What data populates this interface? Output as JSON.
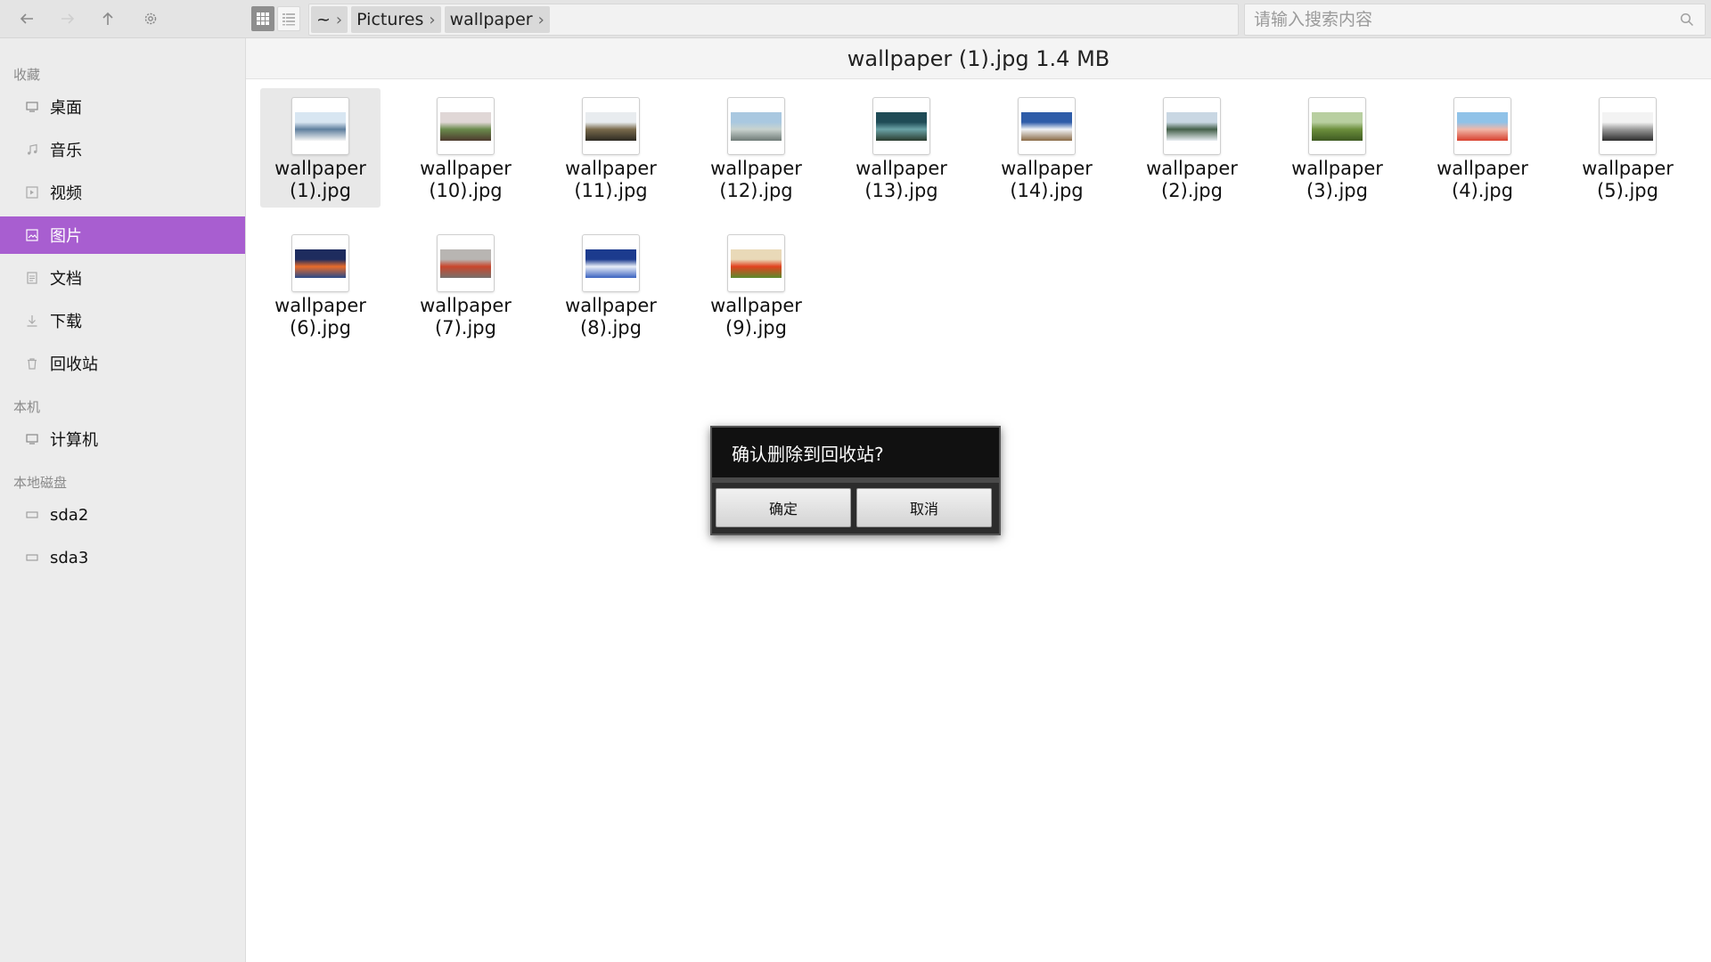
{
  "toolbar": {
    "back_icon": "arrow-left-icon",
    "forward_icon": "arrow-right-icon",
    "up_icon": "arrow-up-icon",
    "settings_icon": "gear-icon",
    "grid_view_icon": "grid-view-icon",
    "list_view_icon": "list-view-icon"
  },
  "breadcrumb": {
    "items": [
      "~",
      "Pictures",
      "wallpaper"
    ]
  },
  "search": {
    "placeholder": "请输入搜索内容",
    "value": ""
  },
  "sidebar": {
    "favorites_title": "收藏",
    "favorites": [
      {
        "label": "桌面",
        "icon": "desktop-icon"
      },
      {
        "label": "音乐",
        "icon": "music-icon"
      },
      {
        "label": "视频",
        "icon": "video-icon"
      },
      {
        "label": "图片",
        "icon": "picture-icon",
        "active": true
      },
      {
        "label": "文档",
        "icon": "document-icon"
      },
      {
        "label": "下载",
        "icon": "download-icon"
      },
      {
        "label": "回收站",
        "icon": "trash-icon"
      }
    ],
    "computer_title": "本机",
    "computer": [
      {
        "label": "计算机",
        "icon": "computer-icon"
      }
    ],
    "disks_title": "本地磁盘",
    "disks": [
      {
        "label": "sda2",
        "icon": "drive-icon"
      },
      {
        "label": "sda3",
        "icon": "drive-icon"
      }
    ]
  },
  "info_bar": {
    "text": "wallpaper (1).jpg 1.4 MB"
  },
  "files": [
    {
      "line1": "wallpaper",
      "line2": "(1).jpg",
      "selected": true,
      "colors": [
        "#d8e6f2",
        "#5f7f9e",
        "#f5f5f5"
      ]
    },
    {
      "line1": "wallpaper",
      "line2": "(10).jpg",
      "colors": [
        "#e0d7d6",
        "#6a8a4c",
        "#4d3a2e"
      ]
    },
    {
      "line1": "wallpaper",
      "line2": "(11).jpg",
      "colors": [
        "#e8ecef",
        "#7a6b4c",
        "#2d2a22"
      ]
    },
    {
      "line1": "wallpaper",
      "line2": "(12).jpg",
      "colors": [
        "#a9c8e0",
        "#c9d3cf",
        "#6e7a76"
      ]
    },
    {
      "line1": "wallpaper",
      "line2": "(13).jpg",
      "colors": [
        "#1f4b56",
        "#6ba3a7",
        "#2a3b2e"
      ]
    },
    {
      "line1": "wallpaper",
      "line2": "(14).jpg",
      "colors": [
        "#2e5ca8",
        "#f0f3f7",
        "#8a6a45"
      ]
    },
    {
      "line1": "wallpaper",
      "line2": "(2).jpg",
      "colors": [
        "#c9d7e3",
        "#44604a",
        "#e8eef2"
      ]
    },
    {
      "line1": "wallpaper",
      "line2": "(3).jpg",
      "colors": [
        "#b8cfa0",
        "#6c8f3c",
        "#3e5a22"
      ]
    },
    {
      "line1": "wallpaper",
      "line2": "(4).jpg",
      "colors": [
        "#8fc2e8",
        "#f0b7a8",
        "#d8402e"
      ]
    },
    {
      "line1": "wallpaper",
      "line2": "(5).jpg",
      "colors": [
        "#f3f3f3",
        "#9a9a9a",
        "#2d2d2d"
      ]
    },
    {
      "line1": "wallpaper",
      "line2": "(6).jpg",
      "colors": [
        "#1e2c5e",
        "#e86c2a",
        "#2a4a8a"
      ]
    },
    {
      "line1": "wallpaper",
      "line2": "(7).jpg",
      "colors": [
        "#b8b5b2",
        "#c9462c",
        "#77706b"
      ]
    },
    {
      "line1": "wallpaper",
      "line2": "(8).jpg",
      "colors": [
        "#1c3b8e",
        "#e9eef8",
        "#3a62c0"
      ]
    },
    {
      "line1": "wallpaper",
      "line2": "(9).jpg",
      "colors": [
        "#e9d9b8",
        "#e2421f",
        "#5a8a2c"
      ]
    }
  ],
  "dialog": {
    "message": "确认删除到回收站?",
    "confirm_label": "确定",
    "cancel_label": "取消"
  },
  "colors": {
    "accent": "#a85ed0",
    "dialog_bg": "#111111"
  }
}
